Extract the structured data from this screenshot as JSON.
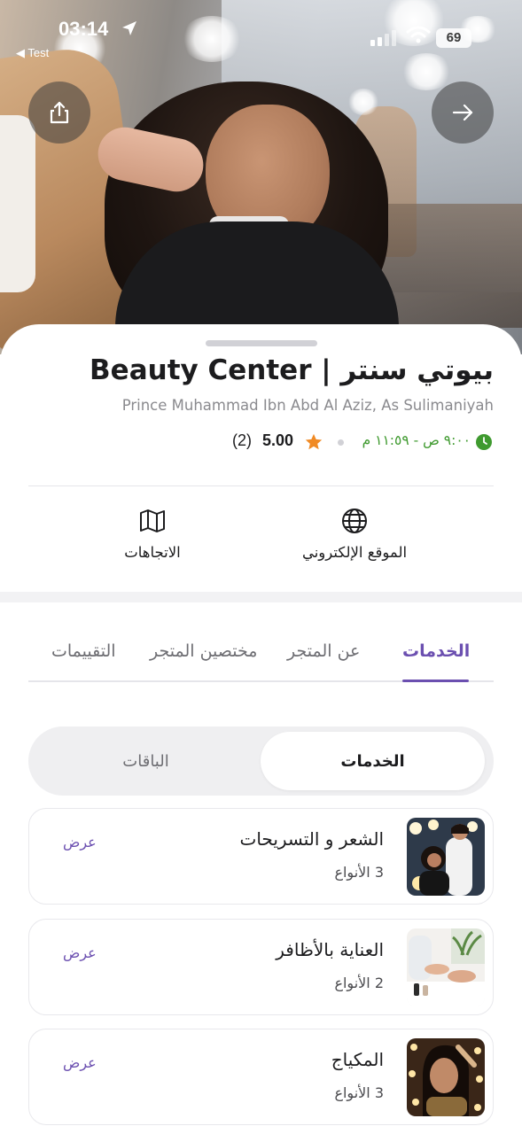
{
  "status_bar": {
    "time": "03:14",
    "back_app": "◀ Test",
    "battery": "69"
  },
  "header": {
    "share_icon": "share-icon",
    "forward_icon": "arrow-right-icon"
  },
  "store": {
    "title": "بيوتي سنتر | Beauty Center",
    "address": "Prince Muhammad Ibn Abd Al Aziz, As Sulimaniyah",
    "hours": "٩:٠٠ ص - ١١:٥٩ م",
    "rating": "5.00",
    "reviews_count": "(2)"
  },
  "actions": {
    "website_label": "الموقع الإلكتروني",
    "directions_label": "الاتجاهات"
  },
  "tabs": [
    {
      "label": "الخدمات",
      "active": true
    },
    {
      "label": "عن المتجر",
      "active": false
    },
    {
      "label": "مختصين المتجر",
      "active": false
    },
    {
      "label": "التقييمات",
      "active": false
    }
  ],
  "segmented": {
    "services": "الخدمات",
    "packages": "الباقات",
    "selected": "الخدمات"
  },
  "services": [
    {
      "name": "الشعر و التسريحات",
      "count": "3 الأنواع",
      "action": "عرض"
    },
    {
      "name": "العناية بالأظافر",
      "count": "2 الأنواع",
      "action": "عرض"
    },
    {
      "name": "المكياج",
      "count": "3 الأنواع",
      "action": "عرض"
    }
  ],
  "colors": {
    "accent": "#6b4fb0",
    "open_hours": "#3f9a2f",
    "star": "#f08a24"
  }
}
